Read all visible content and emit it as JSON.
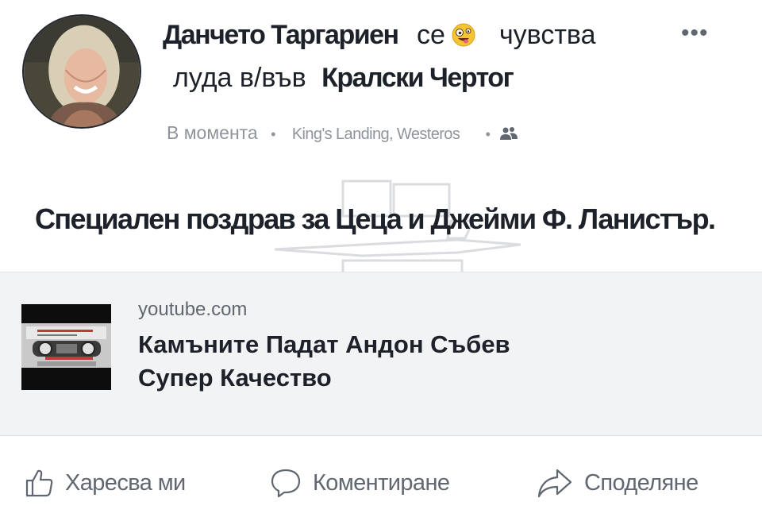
{
  "post": {
    "author": "Данчето Таргариен",
    "activity_prefix": "се",
    "feeling": "чувства",
    "feeling_detail": "луда в/във",
    "place": "Кралски Чертог",
    "more_label": "•••",
    "emoji_icon": "crazy-face-emoji",
    "timestamp": "В момента",
    "location": "King's Landing, Westeros",
    "separator": "•",
    "audience_icon": "friends-icon",
    "text": "Специален поздрав за Цеца и Джейми Ф. Ланистър."
  },
  "link_preview": {
    "domain": "youtube.com",
    "title_line1": "Камъните Падат Андон Събев",
    "title_line2": "Супер Качество"
  },
  "actions": {
    "like": "Харесва ми",
    "comment": "Коментиране",
    "share": "Споделяне"
  },
  "colors": {
    "text": "#1d2129",
    "muted": "#606770",
    "meta": "#90949c",
    "preview_bg": "#f2f3f5"
  }
}
